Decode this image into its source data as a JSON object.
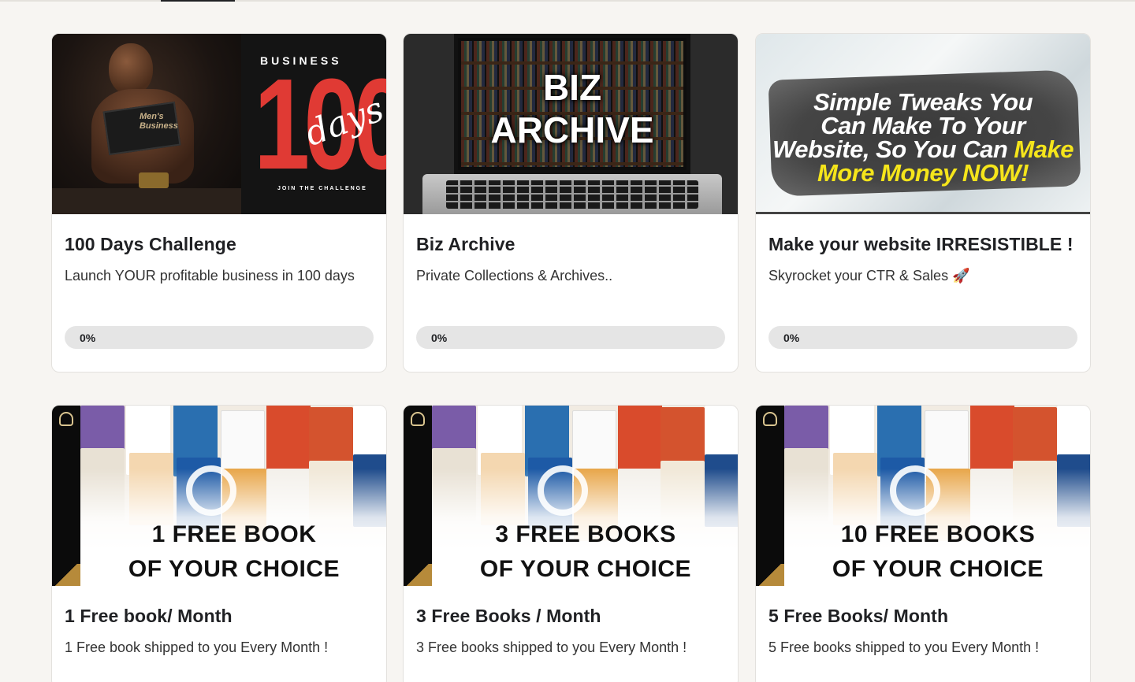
{
  "tabs": {
    "active_indicator": true
  },
  "cards": [
    {
      "title": "100 Days Challenge",
      "description": "Launch YOUR profitable business in 100 days",
      "progress_label": "0%",
      "progress_value": 0,
      "thumbnail": {
        "top_text": "BUSINESS",
        "big_text": "100",
        "script_text": "days",
        "footer_text": "JOIN THE CHALLENGE",
        "book_text": "Men's Business"
      }
    },
    {
      "title": "Biz Archive",
      "description": "Private Collections & Archives..",
      "progress_label": "0%",
      "progress_value": 0,
      "thumbnail": {
        "line1": "BIZ",
        "line2": "ARCHIVE"
      }
    },
    {
      "title": "Make your website IRRESISTIBLE !",
      "description": "Skyrocket your CTR & Sales 🚀",
      "progress_label": "0%",
      "progress_value": 0,
      "thumbnail": {
        "line1": "Simple Tweaks You",
        "line2": "Can Make To Your",
        "line3a": "Website, So You Can ",
        "line3b": "Make",
        "line4": "More Money NOW!"
      }
    },
    {
      "title": "1 Free book/ Month",
      "description": "1 Free book shipped to you Every Month !",
      "thumbnail": {
        "line1": "1 FREE BOOK",
        "line2": "OF YOUR CHOICE"
      }
    },
    {
      "title": "3 Free Books / Month",
      "description": "3 Free books shipped to you Every Month !",
      "thumbnail": {
        "line1": "3 FREE BOOKS",
        "line2": "OF YOUR CHOICE"
      }
    },
    {
      "title": "5 Free Books/ Month",
      "description": "5 Free books shipped to you Every Month !",
      "thumbnail": {
        "line1": "10 FREE BOOKS",
        "line2": "OF YOUR CHOICE"
      }
    }
  ],
  "colors": {
    "page_bg": "#f7f5f2",
    "progress_track": "#e5e5e5",
    "accent_red": "#e03a34",
    "accent_yellow": "#f5e51b"
  }
}
